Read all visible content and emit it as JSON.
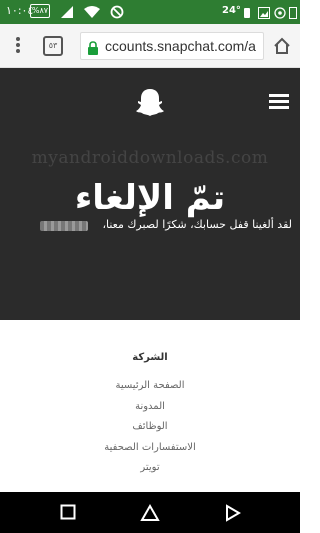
{
  "status_bar": {
    "time": "١٠:٠٤",
    "battery": "%٨٧",
    "temperature": "24°",
    "icons": [
      "battery-icon",
      "signal-icon",
      "wifi-icon",
      "do-not-disturb-icon",
      "weather-icon",
      "gallery-icon",
      "whatsapp-icon",
      "sim-icon"
    ]
  },
  "browser": {
    "tab_count": "٥٣",
    "url": "ccounts.snapchat.com/a",
    "icons": [
      "menu-dots-icon",
      "tabs-icon",
      "lock-icon",
      "home-icon"
    ]
  },
  "hero": {
    "watermark": "myandroiddownloads.com",
    "title": "تمّ الإلغاء",
    "message": "لقد ألغينا قفل حسابك، شكرًا لصبرك معنا،",
    "background": "#2b2b2b"
  },
  "footer": {
    "heading": "الشركة",
    "links": [
      "الصفحة الرئيسية",
      "المدونة",
      "الوظائف",
      "الاستفسارات الصحفية",
      "تويتر"
    ]
  },
  "nav_bar": {
    "icons": [
      "recents-icon",
      "home-icon",
      "back-icon"
    ]
  },
  "colors": {
    "status_bar": "#2e7d32",
    "hero": "#2b2b2b",
    "lock": "#1a9e3a"
  }
}
